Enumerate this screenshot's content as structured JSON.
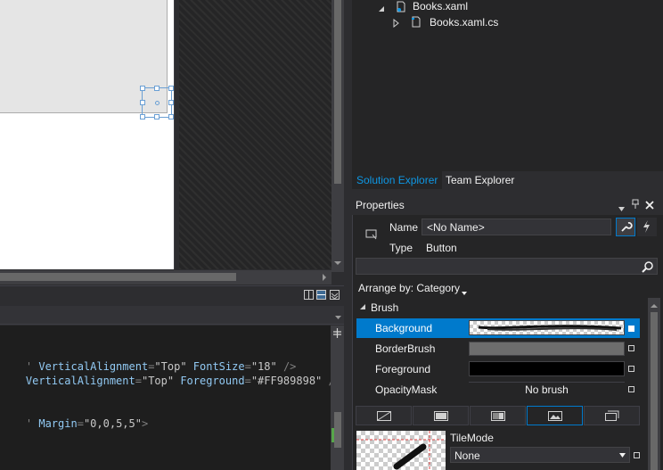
{
  "solution_explorer": {
    "tree": [
      {
        "label": "Books.xaml",
        "icon": "xaml-file-icon",
        "expanded": true
      },
      {
        "label": "Books.xaml.cs",
        "icon": "csharp-file-icon",
        "expanded": false
      }
    ],
    "tabs": [
      "Solution Explorer",
      "Team Explorer"
    ],
    "active_tab": "Solution Explorer"
  },
  "properties": {
    "title": "Properties",
    "name_label": "Name",
    "name_value": "<No Name>",
    "type_label": "Type",
    "type_value": "Button",
    "search_placeholder": "",
    "arrange_by": "Arrange by: Category",
    "category": "Brush",
    "brushes": [
      {
        "label": "Background",
        "value": "",
        "selected": true
      },
      {
        "label": "BorderBrush",
        "value": "",
        "selected": false
      },
      {
        "label": "Foreground",
        "value": "",
        "selected": false
      },
      {
        "label": "OpacityMask",
        "value": "No brush",
        "selected": false
      }
    ],
    "brush_types": [
      "no-brush-icon",
      "solid-brush-icon",
      "gradient-brush-icon",
      "image-brush-icon",
      "resource-brush-icon"
    ],
    "active_brush_type": "image-brush-icon",
    "tile_mode_label": "TileMode",
    "tile_mode_value": "None"
  },
  "editor": {
    "lines": [
      {
        "pre": "' ",
        "attrs": [
          {
            "name": "VerticalAlignment",
            "value": "\"Top\""
          },
          {
            "name": "FontSize",
            "value": "\"18\""
          }
        ],
        "close": " />"
      },
      {
        "pre": "",
        "attrs": [
          {
            "name": "VerticalAlignment",
            "value": "\"Top\""
          },
          {
            "name": "Foreground",
            "value": "\"#FF989898\""
          }
        ],
        "close": " />"
      },
      {
        "pre": "' ",
        "attrs": [
          {
            "name": "Margin",
            "value": "\"0,0,5,5\""
          }
        ],
        "close": ">"
      }
    ]
  },
  "colors": {
    "accent": "#007acc",
    "link_blue": "#0e97e4",
    "border_brush": "#6d6d6d",
    "foreground": "#000000"
  }
}
